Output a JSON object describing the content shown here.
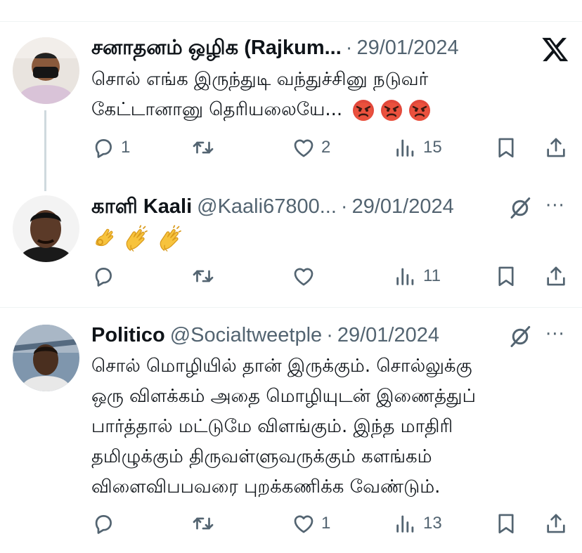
{
  "tweets": [
    {
      "name": "சனாதனம் ஒழிக (Rajkum...",
      "handle": "",
      "dot": "·",
      "date": "29/01/2024",
      "lines": [
        "சொல் எங்க இருந்துடி வந்துச்சினு நடுவர்",
        "கேட்டானானு தெரியலையே..."
      ],
      "emojis": [
        "angry-face",
        "angry-face",
        "angry-face"
      ],
      "reply_count": "1",
      "retweet_count": "",
      "like_count": "2",
      "view_count": "15",
      "corner_icon": "x-logo-icon"
    },
    {
      "name": "காளி Kaali",
      "handle": "@Kaali67800...",
      "dot": "·",
      "date": "29/01/2024",
      "lines": [],
      "emojis": [
        "ok-hand",
        "clapping-hands",
        "clapping-hands"
      ],
      "reply_count": "",
      "retweet_count": "",
      "like_count": "",
      "view_count": "11",
      "corner_icon": "grok-icon"
    },
    {
      "name": "Politico",
      "handle": "@Socialtweetple",
      "dot": "·",
      "date": "29/01/2024",
      "lines": [
        "சொல் மொழியில் தான் இருக்கும். சொல்லுக்கு",
        "ஒரு விளக்கம் அதை மொழியுடன் இணைத்துப்",
        "பார்த்தால் மட்டுமே விளங்கும்.  இந்த மாதிரி",
        "தமிழுக்கும் திருவள்ளுவருக்கும் களங்கம்",
        "விளைவிபபவரை புறக்கணிக்க வேண்டும்."
      ],
      "emojis": [],
      "reply_count": "",
      "retweet_count": "",
      "like_count": "1",
      "view_count": "13",
      "corner_icon": "grok-icon"
    }
  ],
  "colors": {
    "text": "#0f1419",
    "muted": "#536471",
    "divider": "#eff3f4",
    "thread": "#cfd9de"
  }
}
